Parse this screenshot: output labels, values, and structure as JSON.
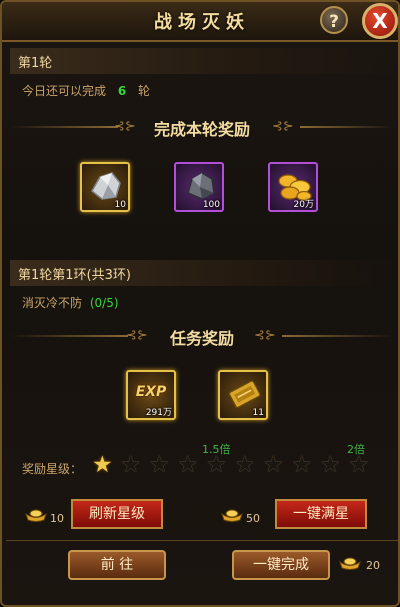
{
  "window": {
    "title": "战场灭妖",
    "help_glyph": "?",
    "close_glyph": "X"
  },
  "round": {
    "header": "第1轮",
    "remaining_prefix": "今日还可以完成",
    "remaining_count": "6",
    "remaining_suffix": "轮"
  },
  "round_rewards": {
    "title": "完成本轮奖励",
    "items": [
      {
        "icon": "silver-ore-icon",
        "quantity": "10",
        "frame": "gold"
      },
      {
        "icon": "dark-ore-icon",
        "quantity": "100",
        "frame": "purple"
      },
      {
        "icon": "gold-coins-icon",
        "quantity": "20万",
        "frame": "purple"
      }
    ]
  },
  "ring": {
    "header": "第1轮第1环(共3环)",
    "task_text": "消灭冷不防",
    "task_progress": "(0/5)"
  },
  "task_rewards": {
    "title": "任务奖励",
    "items": [
      {
        "icon": "exp-icon",
        "label": "EXP",
        "quantity": "291万",
        "frame": "gold"
      },
      {
        "icon": "gold-ticket-icon",
        "quantity": "11",
        "frame": "gold"
      }
    ]
  },
  "star_rating": {
    "label": "奖励星级：",
    "total": 10,
    "filled": 1,
    "multiplier_mid": "1.5倍",
    "multiplier_max": "2倍"
  },
  "actions": {
    "refresh_cost": "10",
    "refresh_label": "刷新星级",
    "max_cost": "50",
    "max_label": "一键满星",
    "goto_label": "前  往",
    "complete_label": "一键完成",
    "complete_cost": "20"
  },
  "colors": {
    "accent": "#f3dc9c",
    "highlight_green": "#38d63c",
    "star_gold": "#f2c94c",
    "button_red": "#c4281a"
  }
}
